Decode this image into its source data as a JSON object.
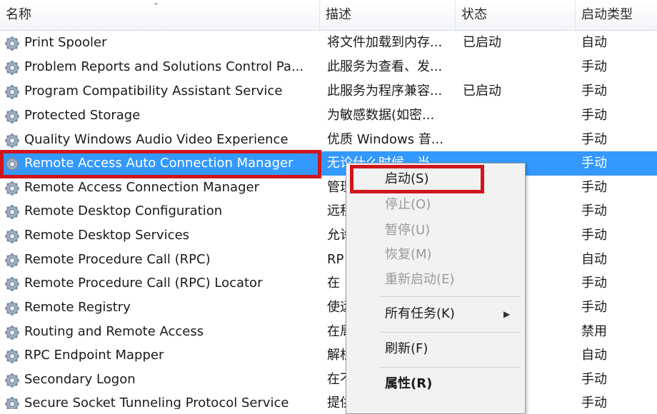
{
  "columns": {
    "name": "名称",
    "description": "描述",
    "status": "状态",
    "startup_type": "启动类型"
  },
  "rows": [
    {
      "name": "Print Spooler",
      "description": "将文件加载到内存...",
      "status": "已启动",
      "startup_type": "自动"
    },
    {
      "name": "Problem Reports and Solutions Control Pa...",
      "description": "此服务为查看、发...",
      "status": "",
      "startup_type": "手动"
    },
    {
      "name": "Program Compatibility Assistant Service",
      "description": "此服务为程序兼容...",
      "status": "已启动",
      "startup_type": "手动"
    },
    {
      "name": "Protected Storage",
      "description": "为敏感数据(如密...",
      "status": "",
      "startup_type": "手动"
    },
    {
      "name": "Quality Windows Audio Video Experience",
      "description": "优质 Windows 音...",
      "status": "",
      "startup_type": "手动"
    },
    {
      "name": "Remote Access Auto Connection Manager",
      "description": "无论什么时候，当...",
      "status": "",
      "startup_type": "手动"
    },
    {
      "name": "Remote Access Connection Manager",
      "description": "管理",
      "status": "",
      "startup_type": "手动"
    },
    {
      "name": "Remote Desktop Configuration",
      "description": "远程",
      "status": "",
      "startup_type": "手动"
    },
    {
      "name": "Remote Desktop Services",
      "description": "允许",
      "status": "",
      "startup_type": "手动"
    },
    {
      "name": "Remote Procedure Call (RPC)",
      "description": "RP",
      "status": "",
      "startup_type": "自动"
    },
    {
      "name": "Remote Procedure Call (RPC) Locator",
      "description": "在",
      "status": "",
      "startup_type": "手动"
    },
    {
      "name": "Remote Registry",
      "description": "使远",
      "status": "",
      "startup_type": "手动"
    },
    {
      "name": "Routing and Remote Access",
      "description": "在局",
      "status": "",
      "startup_type": "禁用"
    },
    {
      "name": "RPC Endpoint Mapper",
      "description": "解析",
      "status": "",
      "startup_type": "自动"
    },
    {
      "name": "Secondary Logon",
      "description": "在不",
      "status": "",
      "startup_type": "手动"
    },
    {
      "name": "Secure Socket Tunneling Protocol Service",
      "description": "提供",
      "status": "",
      "startup_type": "手动"
    }
  ],
  "context_menu": {
    "start": "启动(S)",
    "stop": "停止(O)",
    "pause": "暂停(U)",
    "resume": "恢复(M)",
    "restart": "重新启动(E)",
    "all_tasks": "所有任务(K)",
    "refresh": "刷新(F)",
    "properties": "属性(R)"
  },
  "colors": {
    "selection": "#3399ff",
    "highlight_box": "#d0161c"
  },
  "icons": {
    "row": "gear-icon",
    "submenu": "chevron-right-icon",
    "sort": "sort-arrow-icon"
  }
}
